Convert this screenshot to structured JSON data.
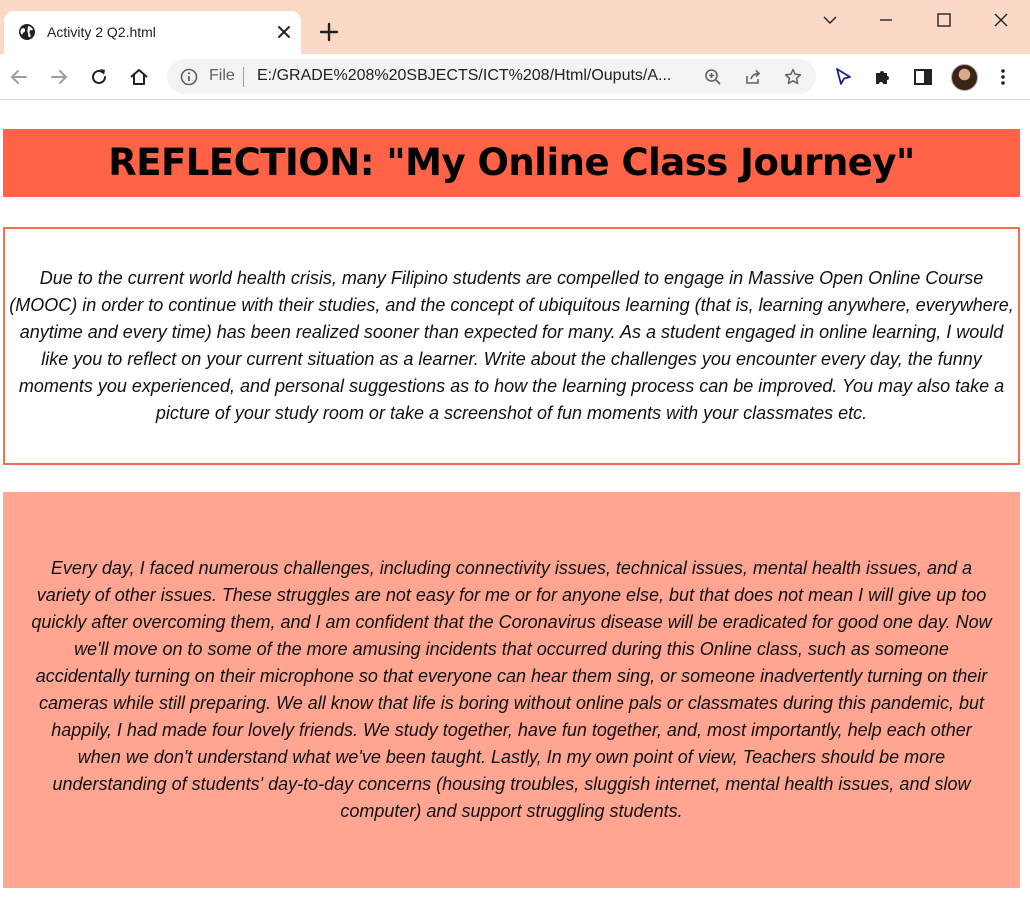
{
  "browser": {
    "tab_title": "Activity 2 Q2.html",
    "address_scheme_label": "File",
    "address_url": "E:/GRADE%208%20SBJECTS/ICT%208/Html/Ouputs/A...",
    "icons": {
      "tab": "globe-icon",
      "close_tab": "close-icon",
      "new_tab": "plus-icon",
      "back": "back-arrow-icon",
      "forward": "forward-arrow-icon",
      "reload": "reload-icon",
      "home": "home-icon",
      "info": "info-icon",
      "zoom": "zoom-icon",
      "share": "share-icon",
      "bookmark": "star-icon",
      "cursor_extension": "cursor-icon",
      "extensions": "puzzle-icon",
      "side_panel": "side-panel-icon",
      "profile": "avatar",
      "menu": "kebab-menu-icon"
    },
    "colors": {
      "titlebar": "#fcd9c6",
      "toolbar": "#ffffff",
      "omnibox": "#f1f3f4"
    }
  },
  "page": {
    "heading": "REFLECTION: \"My Online Class Journey\"",
    "prompt": "Due to the current world health crisis, many Filipino students are compelled to engage in Massive Open Online Course (MOOC) in order to continue with their studies, and the concept of ubiquitous learning (that is, learning anywhere, everywhere, anytime and every time) has been realized sooner than expected for many. As a student engaged in online learning, I would like you to reflect on your current situation as a learner. Write about the challenges you encounter every day, the funny moments you experienced, and personal suggestions as to how the learning process can be improved. You may also take a picture of your study room or take a screenshot of fun moments with your classmates etc.",
    "answer": "Every day, I faced numerous challenges, including connectivity issues, technical issues, mental health issues, and a variety of other issues. These struggles are not easy for me or for anyone else, but that does not mean I will give up too quickly after overcoming them, and I am confident that the Coronavirus disease will be eradicated for good one day. Now we'll move on to some of the more amusing incidents that occurred during this Online class, such as someone accidentally turning on their microphone so that everyone can hear them sing, or someone inadvertently turning on their cameras while still preparing. We all know that life is boring without online pals or classmates during this pandemic, but happily, I had made four lovely friends. We study together, have fun together, and, most importantly, help each other when we don't understand what we've been taught. Lastly, In my own point of view, Teachers should be more understanding of students' day-to-day concerns (housing troubles, sluggish internet, mental health issues, and slow computer) and support struggling students.",
    "colors": {
      "heading_band": "#ff6347",
      "prompt_border": "#f0714f",
      "answer_background": "#ffa592"
    }
  }
}
